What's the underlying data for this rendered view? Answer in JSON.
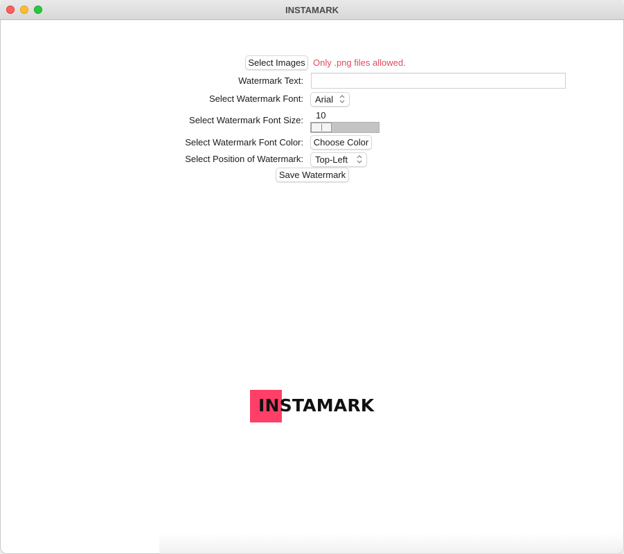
{
  "window": {
    "title": "INSTAMARK"
  },
  "form": {
    "select_images_button": "Select Images",
    "file_hint": "Only .png files allowed.",
    "watermark_text_label": "Watermark Text:",
    "watermark_text_value": "",
    "font_label": "Select Watermark Font:",
    "font_value": "Arial",
    "font_size_label": "Select Watermark Font Size:",
    "font_size_value": "10",
    "font_color_label": "Select Watermark Font Color:",
    "choose_color_button": "Choose Color",
    "position_label": "Select Position of Watermark:",
    "position_value": "Top-Left",
    "save_button": "Save Watermark"
  },
  "logo": {
    "text": "INSTAMARK",
    "accent_color": "#ff3f68"
  },
  "colors": {
    "hint": "#e04a5f"
  }
}
